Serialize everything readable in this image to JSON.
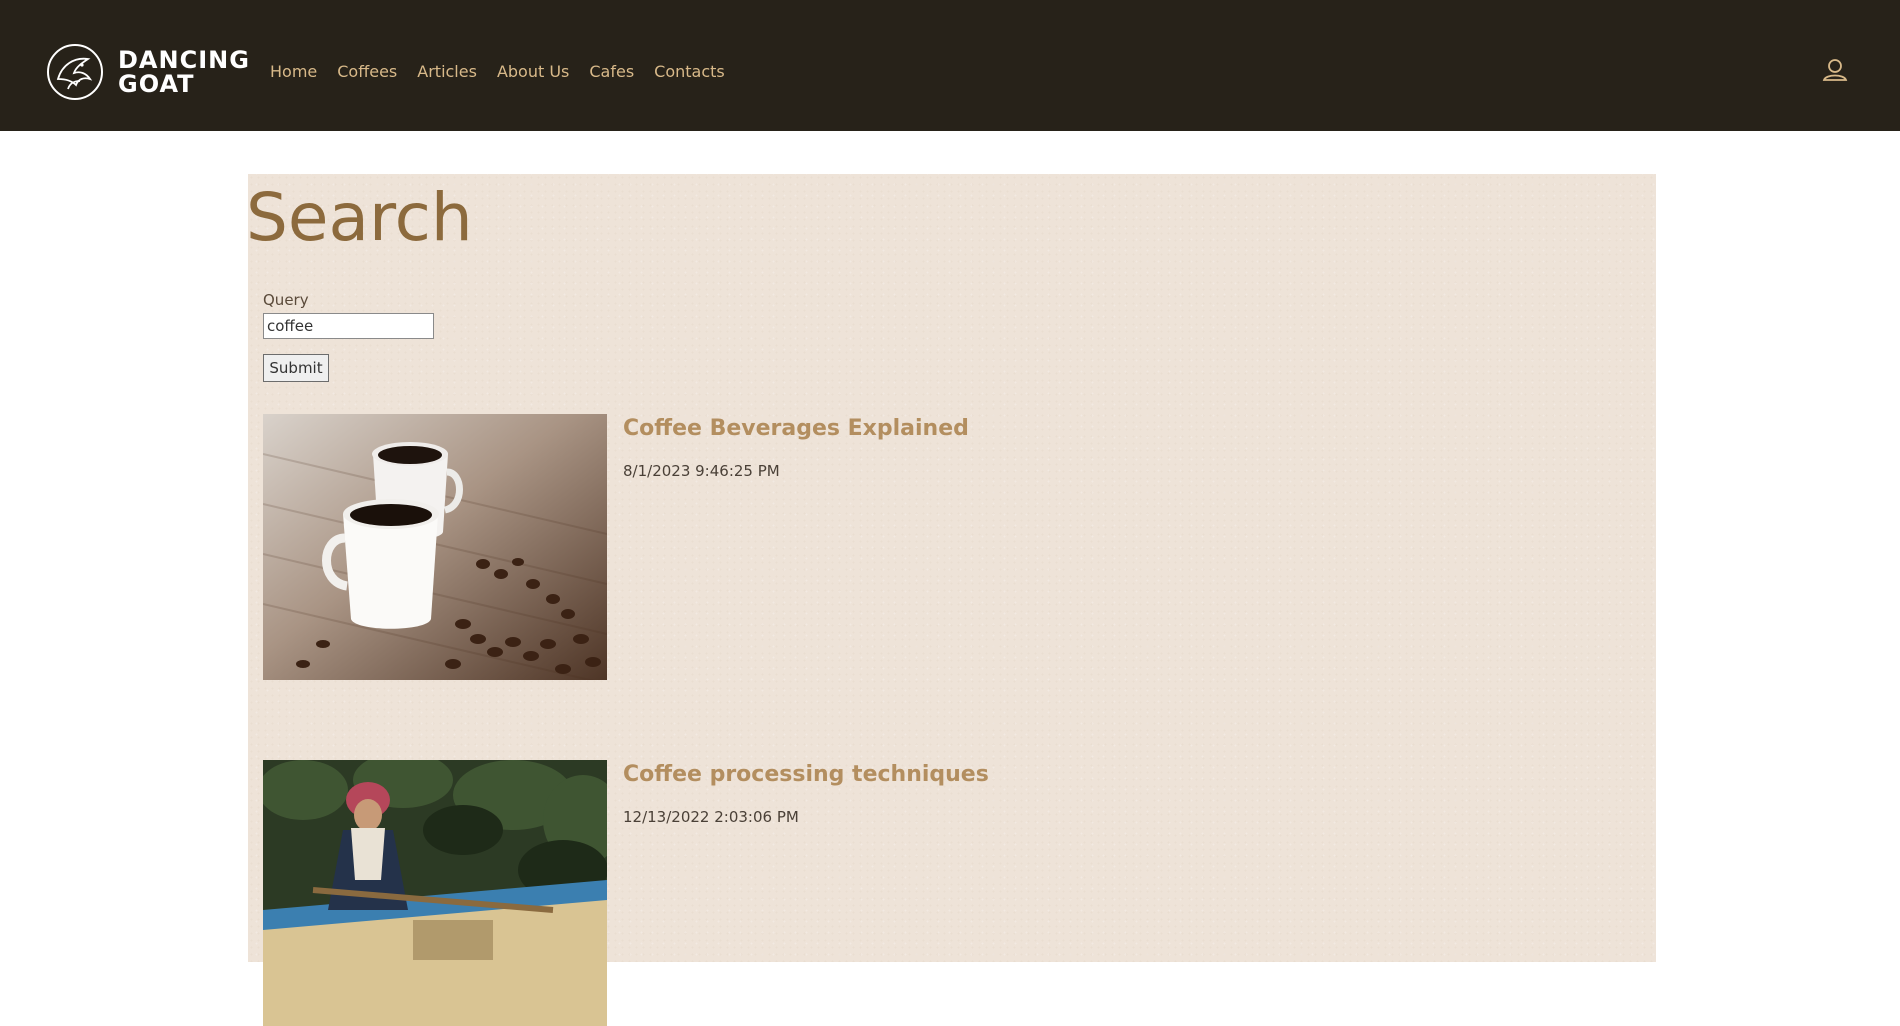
{
  "brand": {
    "line1": "DANCING",
    "line2": "GOAT",
    "logo_icon": "goat-logo-icon"
  },
  "nav": {
    "items": [
      {
        "label": "Home"
      },
      {
        "label": "Coffees"
      },
      {
        "label": "Articles"
      },
      {
        "label": "About Us"
      },
      {
        "label": "Cafes"
      },
      {
        "label": "Contacts"
      }
    ],
    "user_icon": "user-icon"
  },
  "page": {
    "title": "Search"
  },
  "search": {
    "label": "Query",
    "value": "coffee",
    "submit_label": "Submit"
  },
  "results": [
    {
      "title": "Coffee Beverages Explained",
      "date": "8/1/2023 9:46:25 PM",
      "image": "two white espresso cups with coffee beans"
    },
    {
      "title": "Coffee processing techniques",
      "date": "12/13/2022 2:03:06 PM",
      "image": "woman raking coffee beans drying outdoors"
    }
  ],
  "colors": {
    "header_bg": "#272219",
    "nav_link": "#d8b989",
    "page_bg": "#eee3d8",
    "title": "#8c6a3d",
    "result_title": "#b38e5f"
  }
}
